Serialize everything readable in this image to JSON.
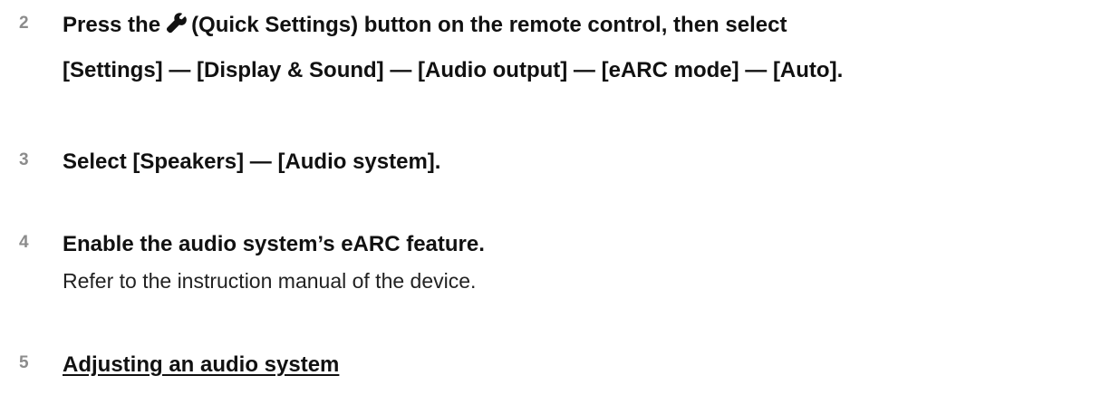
{
  "steps": [
    {
      "number": "2",
      "title_part1": "Press the",
      "icon": "wrench-icon",
      "title_part2": "(Quick Settings) button on the remote control, then select",
      "title_line2": "[Settings] — [Display & Sound] — [Audio output] — [eARC mode] — [Auto]."
    },
    {
      "number": "3",
      "title": "Select [Speakers] — [Audio system]."
    },
    {
      "number": "4",
      "title": "Enable the audio system’s eARC feature.",
      "description": "Refer to the instruction manual of the device."
    },
    {
      "number": "5",
      "link": "Adjusting an audio system"
    }
  ]
}
